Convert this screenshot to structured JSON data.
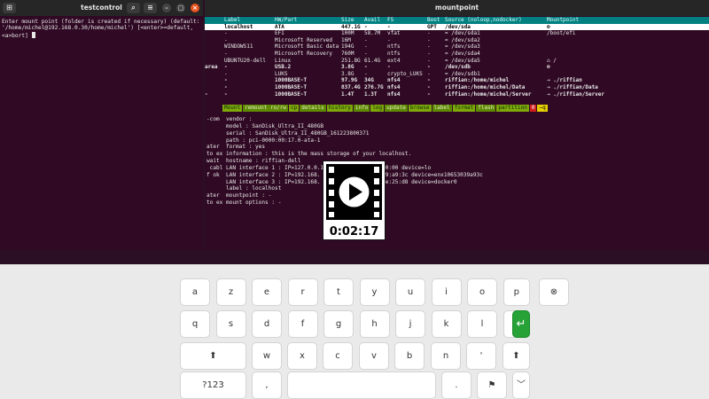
{
  "left_window": {
    "title": "testcontrol",
    "lines": [
      "Enter mount point (folder is created if necessary) (default:",
      "'/home/michel@192.168.0.30/home/michel') [<enter>=default,",
      "<a>bort] "
    ]
  },
  "right_window": {
    "title": "mountpoint",
    "headers": [
      "Label",
      "HW/Part",
      "Size",
      "Avail",
      "FS",
      "Boot",
      "Source (noloop,nodocker)",
      "Mountpoint"
    ],
    "rows": [
      {
        "label": "localhost",
        "hw": "ATA",
        "size": "447.1G",
        "avail": "-",
        "fs": "-",
        "boot": "GPT",
        "source": "/dev/sda",
        "mount": "⊜",
        "style": "selected"
      },
      {
        "label": "-",
        "hw": "EFI",
        "size": "100M",
        "avail": "58.7M",
        "fs": "vfat",
        "boot": "-",
        "source": "= /dev/sda1",
        "mount": "/boot/efi",
        "style": "normal"
      },
      {
        "label": "-",
        "hw": "Microsoft Reserved",
        "size": "16M",
        "avail": "-",
        "fs": "-",
        "boot": "-",
        "source": "= /dev/sda2",
        "mount": "",
        "style": "normal"
      },
      {
        "label": "WINDOWS11",
        "hw": "Microsoft Basic data",
        "size": "194G",
        "avail": "-",
        "fs": "ntfs",
        "boot": "-",
        "source": "= /dev/sda3",
        "mount": "",
        "style": "normal"
      },
      {
        "label": "-",
        "hw": "Microsoft Recovery",
        "size": "760M",
        "avail": "-",
        "fs": "ntfs",
        "boot": "-",
        "source": "= /dev/sda4",
        "mount": "",
        "style": "normal"
      },
      {
        "label": "UBUNTU20-dell",
        "hw": "Linux",
        "size": "251.8G",
        "avail": "61.4G",
        "fs": "ext4",
        "boot": "-",
        "source": "= /dev/sda5",
        "mount": "⌂  /",
        "style": "normal"
      },
      {
        "label": "-",
        "hw": "USB.2",
        "size": "3.8G",
        "avail": "-",
        "fs": "-",
        "boot": "-",
        "source": "/dev/sdb",
        "mount": "⊜",
        "style": "bold"
      },
      {
        "label": "-",
        "hw": "LUKS",
        "size": "3.8G",
        "avail": "-",
        "fs": "crypto_LUKS",
        "boot": "-",
        "source": "= /dev/sdb1",
        "mount": "",
        "style": "normal"
      },
      {
        "label": "-",
        "hw": "1000BASE-T",
        "size": "97.9G",
        "avail": "34G",
        "fs": "nfs4",
        "boot": "-",
        "source": "riffian:/home/michel",
        "mount": "⇢  ./riffian",
        "style": "bold"
      },
      {
        "label": "-",
        "hw": "1000BASE-T",
        "size": "837.4G",
        "avail": "276.7G",
        "fs": "nfs4",
        "boot": "-",
        "source": "riffian:/home/michel/Data",
        "mount": "⇢  ./riffian/Data",
        "style": "bold"
      },
      {
        "label": "-",
        "hw": "1000BASE-T",
        "size": "1.4T",
        "avail": "1.3T",
        "fs": "nfs4",
        "boot": "-",
        "source": "riffian:/home/michel/Server",
        "mount": "⇢  ./riffian/Server",
        "style": "bold"
      }
    ],
    "left_fragments": [
      "",
      "",
      "",
      "",
      "",
      "",
      "",
      "",
      "",
      "",
      ""
    ],
    "menu": [
      "Mount",
      "remount ro/rw",
      "cp",
      "details",
      "history",
      "info",
      "log",
      "update",
      "browse",
      "label",
      "format",
      "flash",
      "partition",
      "0",
      "̶q"
    ],
    "detail_lines": [
      "-com  vendor :",
      "      model : SanDisk_Ultra_II_480GB",
      "      serial : SanDisk_Ultra_II_480GB_161223800371",
      "      path : pci-0000:00:17.0-ata-1",
      "ater  format : yes",
      "to ex information : this is the mass storage of your localhost.",
      "wait  hostname : riffian-dell",
      " cabl LAN interface 1 : IP=127.0.0.1                  00:00 device=lo",
      "f ok  LAN interface 2 : IP=192.168.                  :39:a9:3c device=enx10653039a93c",
      "      LAN interface 3 : IP=192.168.                  :ee:25:d8 device=docker0",
      "      label : localhost",
      "ater  mountpoint : -",
      "to ex mount options : -"
    ],
    "side_text": [
      "",
      "",
      "",
      "",
      "",
      "",
      " area",
      "",
      "",
      "",
      "-"
    ]
  },
  "video": {
    "time": "0:02:17"
  },
  "keyboard": {
    "row1": [
      "a",
      "z",
      "e",
      "r",
      "t",
      "y",
      "u",
      "i",
      "o",
      "p",
      "⊗"
    ],
    "row2": [
      "q",
      "s",
      "d",
      "f",
      "g",
      "h",
      "j",
      "k",
      "l",
      "m",
      "↵"
    ],
    "row3": [
      "⬆",
      "w",
      "x",
      "c",
      "v",
      "b",
      "n",
      "'",
      "⬆"
    ],
    "row4": [
      "?123",
      ",",
      "",
      ".",
      "⚑",
      "﹀"
    ]
  }
}
